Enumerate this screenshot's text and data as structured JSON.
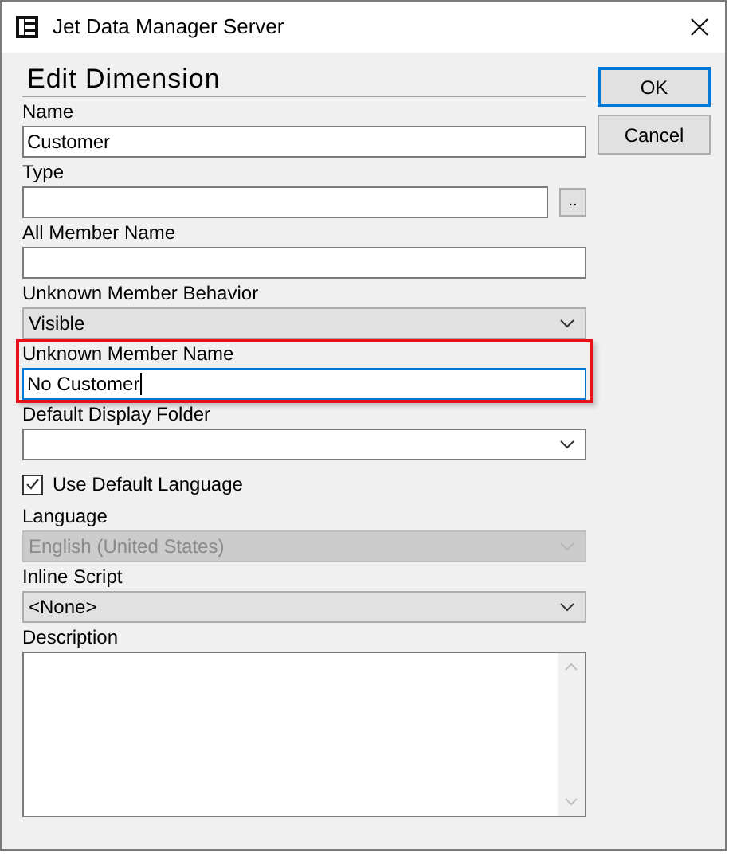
{
  "window": {
    "title": "Jet Data Manager Server"
  },
  "heading": "Edit Dimension",
  "buttons": [
    {
      "label": "OK",
      "default": true
    },
    {
      "label": "Cancel",
      "default": false
    }
  ],
  "fields": [
    {
      "kind": "text",
      "label": "Name",
      "value": "Customer",
      "highlighted": false,
      "focused": false
    },
    {
      "kind": "text-browse",
      "label": "Type",
      "browse": "..",
      "highlighted": false,
      "focused": false
    },
    {
      "kind": "text",
      "label": "All Member Name",
      "highlighted": false,
      "focused": false
    },
    {
      "kind": "combo",
      "label": "Unknown Member Behavior",
      "value": "Visible",
      "disabled": false
    },
    {
      "kind": "text",
      "label": "Unknown Member Name",
      "value": "No Customer",
      "highlighted": true,
      "focused": true
    },
    {
      "kind": "combo-edit",
      "label": "Default Display Folder",
      "disabled": false
    },
    {
      "kind": "checkbox",
      "label": "Use Default Language",
      "checked": true
    },
    {
      "kind": "combo",
      "label": "Language",
      "value": "English (United States)",
      "disabled": true
    },
    {
      "kind": "combo",
      "label": "Inline Script",
      "value": "<None>",
      "disabled": false
    },
    {
      "kind": "textarea",
      "label": "Description"
    }
  ]
}
